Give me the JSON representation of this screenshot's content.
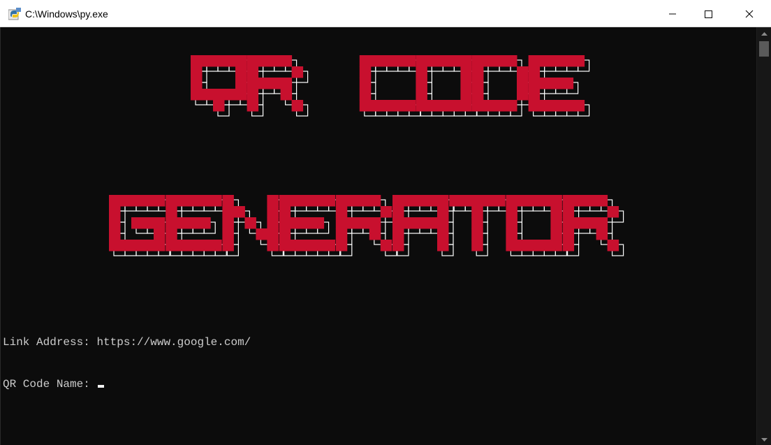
{
  "window": {
    "title": "C:\\Windows\\py.exe",
    "icon": "python-icon",
    "controls": [
      "minimize-icon",
      "maximize-icon",
      "close-icon"
    ]
  },
  "banner": {
    "line1": "QR CODE",
    "line2": "GENERATOR",
    "color": "#c8102e",
    "shadow_color": "#ffffff"
  },
  "console": {
    "lines": [
      {
        "label": "Link Address:",
        "value": "https://www.google.com/"
      },
      {
        "label": "QR Code Name:",
        "value": ""
      }
    ],
    "background": "#0c0c0c",
    "text_color": "#cccccc"
  }
}
